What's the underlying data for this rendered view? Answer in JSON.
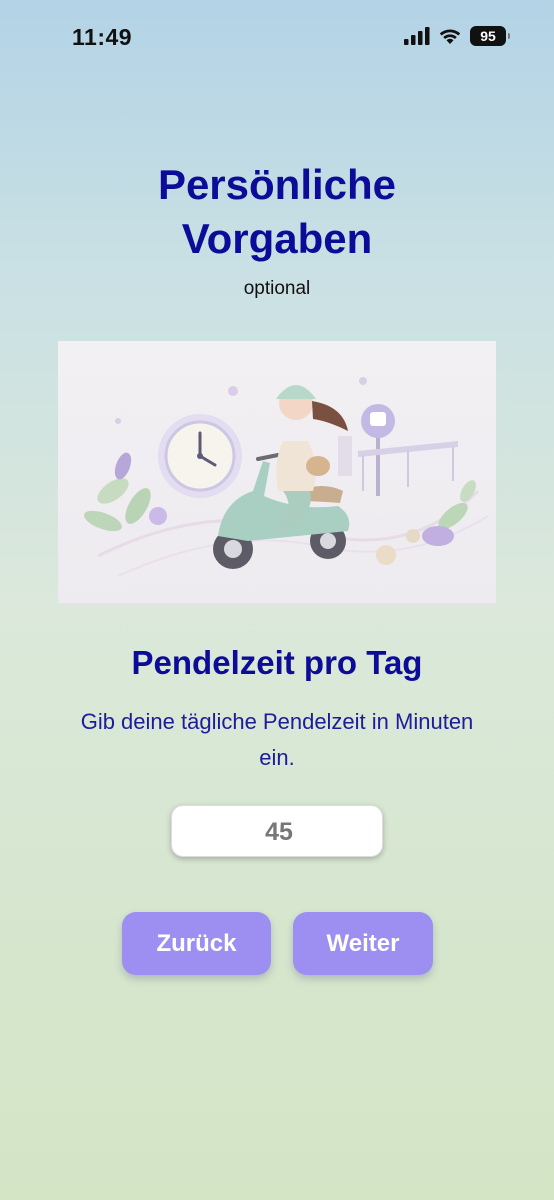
{
  "status_bar": {
    "time": "11:49",
    "battery": "95",
    "icons": [
      "signal-icon",
      "wifi-icon",
      "battery-icon"
    ]
  },
  "header": {
    "title_line1": "Persönliche",
    "title_line2": "Vorgaben",
    "subtitle": "optional"
  },
  "illustration": {
    "icon": "commute-scooter-illustration"
  },
  "commute": {
    "heading": "Pendelzeit pro Tag",
    "instruction": "Gib deine tägliche Pendelzeit in Minuten ein.",
    "input_value": "45"
  },
  "buttons": {
    "back_label": "Zurück",
    "next_label": "Weiter"
  },
  "colors": {
    "accent_text": "#0c0c99",
    "button": "#9d8ff1"
  }
}
